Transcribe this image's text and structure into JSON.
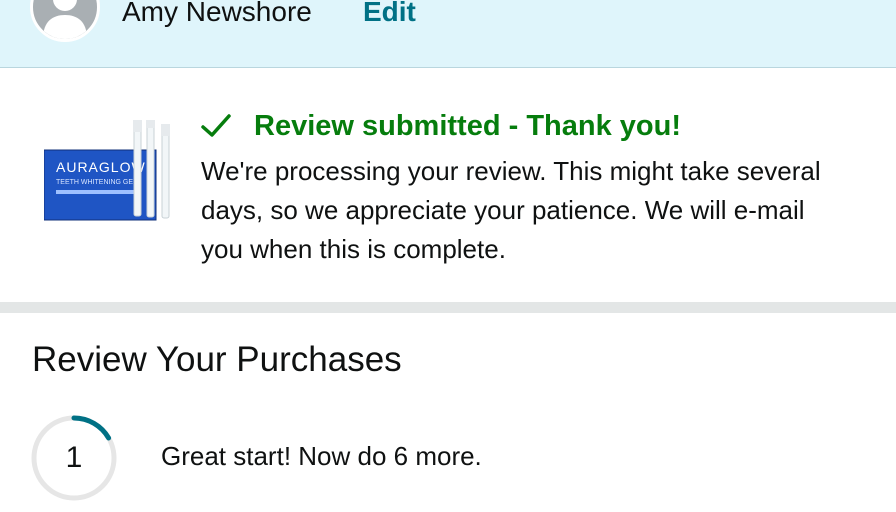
{
  "profile": {
    "name": "Amy Newshore",
    "edit_label": "Edit",
    "avatar_icon": "user-silhouette-icon"
  },
  "confirmation": {
    "title": "Review submitted - Thank you!",
    "message": "We're processing your review. This might take several days, so we appreciate your patience. We will e-mail you when this is complete.",
    "status_icon": "check-icon",
    "product": {
      "brand_text": "AURAGLOW",
      "subtitle_text": "TEETH WHITENING GEL"
    }
  },
  "review_section": {
    "title": "Review Your Purchases",
    "progress": {
      "count": "1",
      "remaining": 6,
      "message": "Great start! Now do 6 more."
    }
  },
  "colors": {
    "profile_bg": "#dff5fb",
    "link": "#007185",
    "success": "#067d0d",
    "progress_track": "#e6e6e6",
    "progress_fill": "#007185"
  }
}
